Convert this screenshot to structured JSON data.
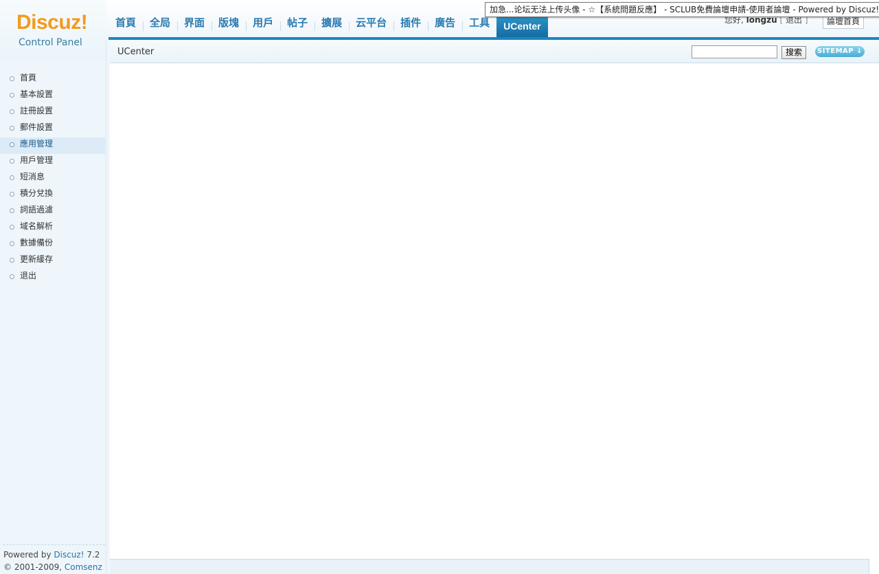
{
  "logo": {
    "brand": "Discuz!",
    "subtitle": "Control Panel"
  },
  "nav": {
    "items": [
      "首頁",
      "全局",
      "界面",
      "版塊",
      "用戶",
      "帖子",
      "擴展",
      "云平台",
      "插件",
      "廣告",
      "工具",
      "UCenter"
    ],
    "active": "UCenter"
  },
  "user": {
    "greeting": "您好,",
    "username": "longzu",
    "logout": "退出",
    "forum_home": "論壇首頁"
  },
  "tooltip": "加急...论坛无法上传头像 - ☆【系統問題反應】 - SCLUB免費論壇申請-使用者論壇 - Powered by Discuz!",
  "breadcrumb": "UCenter",
  "search": {
    "value": "",
    "button": "搜索"
  },
  "sitemap_label": "SITEMAP ↓",
  "sidebar": {
    "items": [
      "首頁",
      "基本設置",
      "註冊設置",
      "郵件設置",
      "應用管理",
      "用戶管理",
      "短消息",
      "積分兌換",
      "詞語過濾",
      "域名解析",
      "數據備份",
      "更新緩存",
      "退出"
    ],
    "active_index": 4
  },
  "footer": {
    "powered_prefix": "Powered by ",
    "powered_link": "Discuz!",
    "version": " 7.2",
    "copyright_prefix": "© 2001-2009, ",
    "company_link": "Comsenz Inc."
  },
  "colors": {
    "accent": "#1b86c1",
    "logo_orange": "#f39a1d",
    "sidebar_bg": "#eef6fb"
  }
}
